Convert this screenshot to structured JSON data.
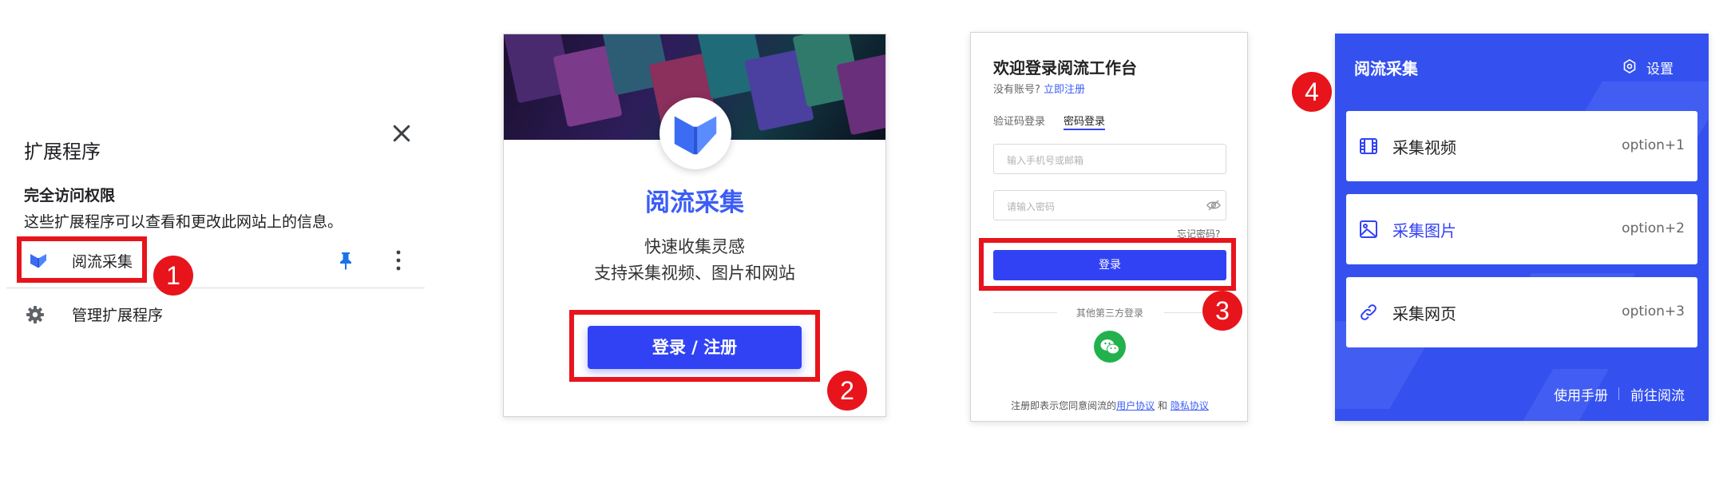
{
  "extensions_popup": {
    "title": "扩展程序",
    "access_title": "完全访问权限",
    "access_desc": "这些扩展程序可以查看和更改此网站上的信息。",
    "extension_name": "阅流采集",
    "manage_label": "管理扩展程序",
    "icons": [
      "close-icon",
      "pin-icon",
      "more-vert-icon",
      "gear-icon",
      "app-logo-icon"
    ]
  },
  "welcome_card": {
    "brand": "阅流采集",
    "line1": "快速收集灵感",
    "line2": "支持采集视频、图片和网站",
    "button": "登录 / 注册"
  },
  "login_panel": {
    "title": "欢迎登录阅流工作台",
    "no_account": "没有账号?",
    "register_link": "立即注册",
    "tab_code": "验证码登录",
    "tab_password": "密码登录",
    "phone_placeholder": "输入手机号或邮箱",
    "password_placeholder": "请输入密码",
    "forgot": "忘记密码?",
    "submit": "登录",
    "third_party": "其他第三方登录",
    "terms_prefix": "注册即表示您同意阅流的",
    "terms_user": "用户协议",
    "terms_and": "和",
    "terms_privacy": "隐私协议"
  },
  "collector_popup": {
    "title": "阅流采集",
    "settings": "设置",
    "items": [
      {
        "label": "采集视频",
        "shortcut": "option+1",
        "icon": "film-icon"
      },
      {
        "label": "采集图片",
        "shortcut": "option+2",
        "icon": "image-icon"
      },
      {
        "label": "采集网页",
        "shortcut": "option+3",
        "icon": "link-icon"
      }
    ],
    "manual": "使用手册",
    "goto": "前往阅流"
  },
  "steps": [
    "1",
    "2",
    "3",
    "4"
  ],
  "colors": {
    "accent_blue": "#3142f5",
    "popup_blue": "#3451f0",
    "annotation_red": "#e8141c",
    "wechat_green": "#22b14c"
  }
}
